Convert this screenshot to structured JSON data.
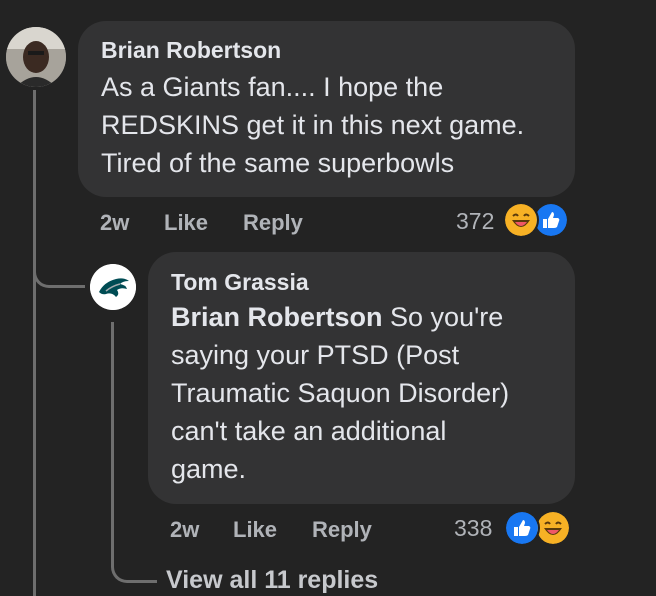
{
  "comments": [
    {
      "author": "Brian Robertson",
      "lines": [
        "As a Giants fan.... I hope the",
        "REDSKINS get it in this next game.",
        "Tired of the same superbowls"
      ],
      "time": "2w",
      "like_label": "Like",
      "reply_label": "Reply",
      "reaction_count": "372",
      "reactions": [
        "laughing-emoji",
        "like-thumb"
      ]
    },
    {
      "author": "Tom Grassia",
      "mention": "Brian Robertson",
      "lines": [
        " So you're",
        "saying your PTSD (Post",
        "Traumatic Saquon Disorder)",
        "can't take an additional",
        "game."
      ],
      "time": "2w",
      "like_label": "Like",
      "reply_label": "Reply",
      "reaction_count": "338",
      "reactions": [
        "like-thumb",
        "laughing-emoji"
      ]
    }
  ],
  "view_replies_label": "View all 11 replies",
  "colors": {
    "background": "#232323",
    "bubble": "#333334",
    "like_blue": "#1877f2",
    "emoji_yellow": "#f7b125"
  }
}
